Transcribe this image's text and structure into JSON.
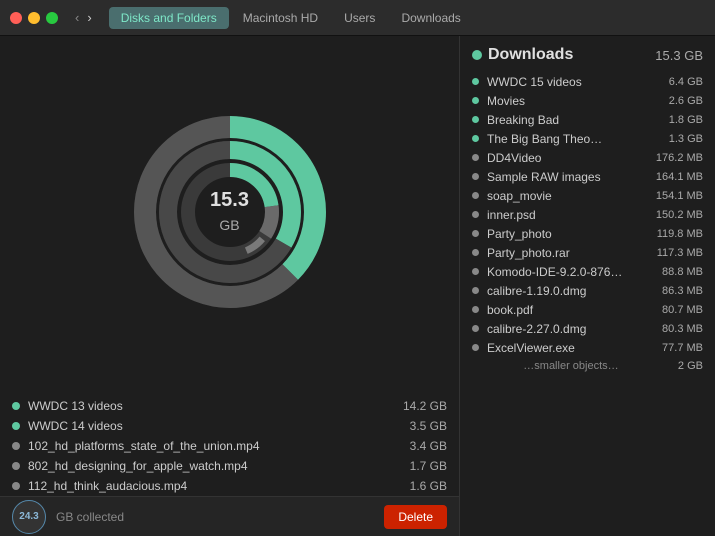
{
  "titlebar": {
    "tabs": [
      "Disks and Folders",
      "Macintosh HD",
      "Users",
      "Downloads"
    ],
    "active_tab": "Disks and Folders"
  },
  "chart": {
    "center_value": "15.3",
    "center_unit": "GB"
  },
  "left_files": [
    {
      "name": "WWDC 13 videos",
      "size": "14.2 GB",
      "color": "#5ec8a0",
      "active": true
    },
    {
      "name": "WWDC 14 videos",
      "size": "3.5 GB",
      "color": "#5ec8a0",
      "active": true
    },
    {
      "name": "102_hd_platforms_state_of_the_union.mp4",
      "size": "3.4 GB",
      "color": "#888",
      "active": false
    },
    {
      "name": "802_hd_designing_for_apple_watch.mp4",
      "size": "1.7 GB",
      "color": "#888",
      "active": false
    },
    {
      "name": "112_hd_think_audacious.mp4",
      "size": "1.6 GB",
      "color": "#888",
      "active": false
    }
  ],
  "bottom_bar": {
    "collected": "24.3",
    "collected_label": "GB collected",
    "delete_label": "Delete"
  },
  "right_panel": {
    "title": "Downloads",
    "title_size": "15.3 GB",
    "items": [
      {
        "name": "WWDC 15 videos",
        "size": "6.4 GB",
        "color": "#5ec8a0",
        "active": true
      },
      {
        "name": "Movies",
        "size": "2.6 GB",
        "color": "#5ec8a0",
        "active": true
      },
      {
        "name": "Breaking Bad",
        "size": "1.8 GB",
        "color": "#5ec8a0",
        "active": true
      },
      {
        "name": "The Big Bang Theo…",
        "size": "1.3 GB",
        "color": "#5ec8a0",
        "active": true
      },
      {
        "name": "DD4Video",
        "size": "176.2 MB",
        "color": "#888",
        "active": false
      },
      {
        "name": "Sample RAW images",
        "size": "164.1 MB",
        "color": "#888",
        "active": false
      },
      {
        "name": "soap_movie",
        "size": "154.1 MB",
        "color": "#888",
        "active": false
      },
      {
        "name": "inner.psd",
        "size": "150.2 MB",
        "color": "#888",
        "active": false
      },
      {
        "name": "Party_photo",
        "size": "119.8 MB",
        "color": "#888",
        "active": false
      },
      {
        "name": "Party_photo.rar",
        "size": "117.3 MB",
        "color": "#888",
        "active": false
      },
      {
        "name": "Komodo-IDE-9.2.0-876…",
        "size": "88.8 MB",
        "color": "#888",
        "active": false
      },
      {
        "name": "calibre-1.19.0.dmg",
        "size": "86.3 MB",
        "color": "#888",
        "active": false
      },
      {
        "name": "book.pdf",
        "size": "80.7 MB",
        "color": "#888",
        "active": false
      },
      {
        "name": "calibre-2.27.0.dmg",
        "size": "80.3 MB",
        "color": "#888",
        "active": false
      },
      {
        "name": "ExcelViewer.exe",
        "size": "77.7 MB",
        "color": "#888",
        "active": false
      }
    ],
    "smaller_objects_label": "…smaller objects…",
    "smaller_objects_size": "2 GB"
  }
}
